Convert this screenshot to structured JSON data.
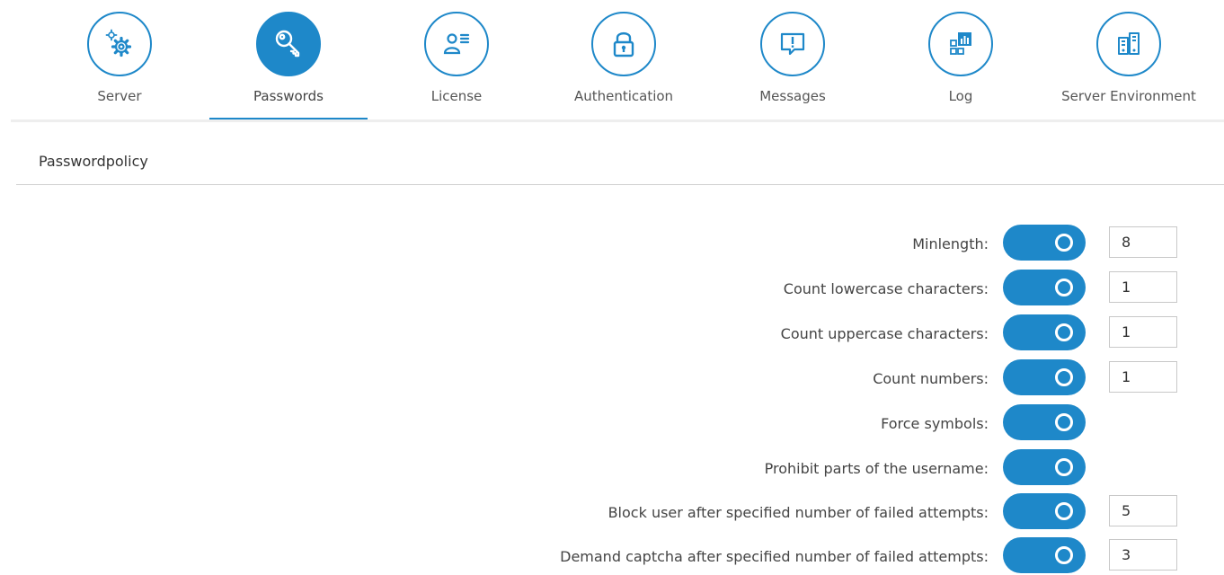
{
  "nav": {
    "active_accent": "#1e88c9",
    "items": [
      {
        "label": "Server",
        "icon": "gears-icon",
        "active": false
      },
      {
        "label": "Passwords",
        "icon": "key-icon",
        "active": true
      },
      {
        "label": "License",
        "icon": "license-user-icon",
        "active": false
      },
      {
        "label": "Authentication",
        "icon": "lock-icon",
        "active": false
      },
      {
        "label": "Messages",
        "icon": "message-alert-icon",
        "active": false
      },
      {
        "label": "Log",
        "icon": "log-chart-icon",
        "active": false
      },
      {
        "label": "Server Environment",
        "icon": "server-environment-icon",
        "active": false
      }
    ]
  },
  "section": {
    "title": "Passwordpolicy"
  },
  "policy": {
    "rows": [
      {
        "label": "Minlength:",
        "enabled": true,
        "value": "8"
      },
      {
        "label": "Count lowercase characters:",
        "enabled": true,
        "value": "1"
      },
      {
        "label": "Count uppercase characters:",
        "enabled": true,
        "value": "1"
      },
      {
        "label": "Count numbers:",
        "enabled": true,
        "value": "1"
      },
      {
        "label": "Force symbols:",
        "enabled": true,
        "value": null
      },
      {
        "label": "Prohibit parts of the username:",
        "enabled": true,
        "value": null
      },
      {
        "label": "Block user after specified number of failed attempts:",
        "enabled": true,
        "value": "5"
      },
      {
        "label": "Demand captcha after specified number of failed attempts:",
        "enabled": true,
        "value": "3"
      }
    ]
  }
}
